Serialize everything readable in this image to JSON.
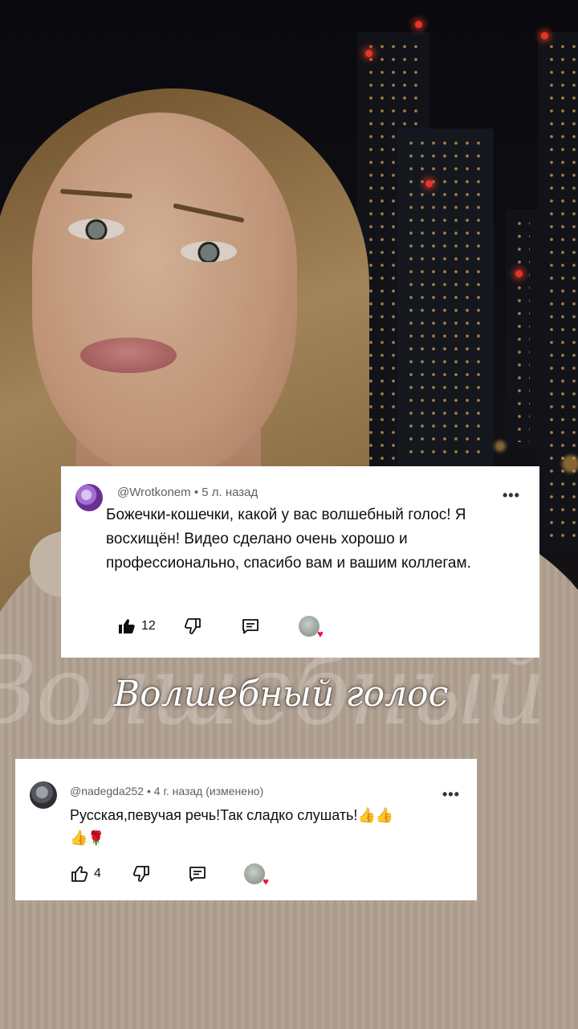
{
  "video": {
    "title_overlay": "Волшебный голос",
    "watermark_text": "Волшебный голос"
  },
  "comments": [
    {
      "author": "@Wrotkonem",
      "age": "5 л. назад",
      "text": "Божечки-кошечки, какой у вас волшебный голос! Я восхищён!  Видео сделано очень хорошо и профессионально, спасибо вам и вашим коллегам.",
      "likes": "12",
      "like_state": "liked",
      "avatar_icon": "purple-profile-avatar",
      "creator_heart": true
    },
    {
      "author": "@nadegda252",
      "age": "4 г. назад (изменено)",
      "text_line1": "Русская,певучая речь!Так сладко слушать!",
      "likes": "4",
      "like_state": "neutral",
      "avatar_icon": "grey-profile-avatar",
      "emojis": [
        "thumbs-up",
        "thumbs-up",
        "thumbs-up",
        "rose"
      ],
      "creator_heart": true
    }
  ],
  "colors": {
    "card_bg": "#ffffff",
    "meta_text": "#606060",
    "heart": "#e8163a"
  }
}
